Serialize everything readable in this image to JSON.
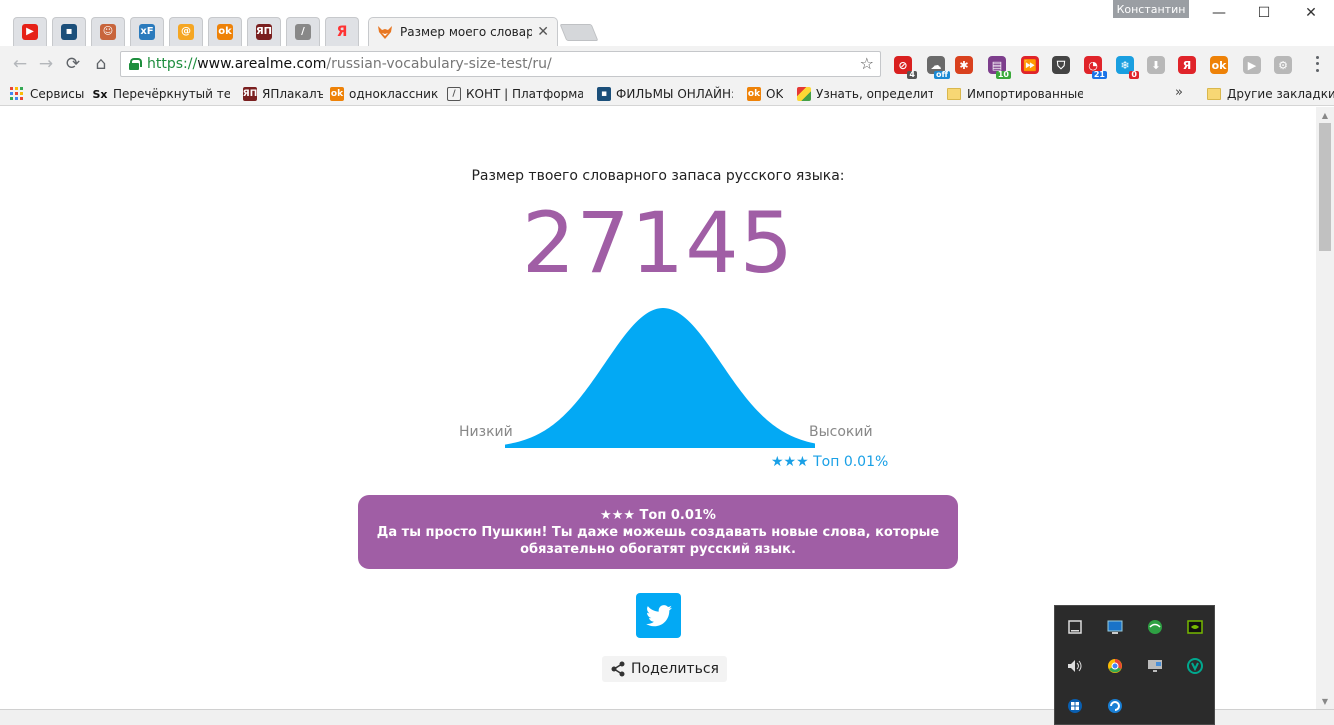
{
  "window": {
    "user_name": "Константин",
    "minimize": "—",
    "maximize": "☐",
    "close": "✕"
  },
  "tabs": {
    "pinned": [
      {
        "icon": "youtube-icon",
        "glyph": "▶",
        "color": "#e62117"
      },
      {
        "icon": "tv-icon",
        "glyph": "▪",
        "color": "#1b4f7a"
      },
      {
        "icon": "mask-icon",
        "glyph": "☺",
        "color": "#c8653c"
      },
      {
        "icon": "xf-icon",
        "glyph": "xF",
        "color": "#2b7bbd"
      },
      {
        "icon": "mail-at-icon",
        "glyph": "@",
        "color": "#f5a623"
      },
      {
        "icon": "odnoklassniki-icon",
        "glyph": "ok",
        "color": "#ee8208"
      },
      {
        "icon": "yaplakal-icon",
        "glyph": "ЯП",
        "color": "#7a1f1f"
      },
      {
        "icon": "kont-icon",
        "glyph": "/",
        "color": "#555555"
      },
      {
        "icon": "yandex-icon",
        "glyph": "Я",
        "color": "#ff3333"
      }
    ],
    "active_title": "Размер моего словарного запаса",
    "active_close": "✕"
  },
  "toolbar": {
    "back": "←",
    "forward": "→",
    "reload": "⟳",
    "home": "⌂",
    "url_scheme": "https://",
    "url_host": "www.arealme.com",
    "url_path": "/russian-vocabulary-size-test/ru/",
    "bookmark_star": "☆",
    "extensions": [
      {
        "icon": "adblock-icon",
        "glyph": "⊘",
        "color": "#d9201f",
        "badge": "4",
        "badge_color": "#555555"
      },
      {
        "icon": "cloud-off-icon",
        "glyph": "☁",
        "color": "#6a6a6a",
        "badge": "off",
        "badge_color": "#1a8ad4"
      },
      {
        "icon": "gear-red-icon",
        "glyph": "✱",
        "color": "#d9411e",
        "badge": "",
        "badge_color": ""
      },
      {
        "icon": "wallet-icon",
        "glyph": "▤",
        "color": "#7d3e8c",
        "badge": "10",
        "badge_color": "#3aa93a"
      },
      {
        "icon": "forward-red-icon",
        "glyph": "⏩",
        "color": "#e0242a",
        "badge": "",
        "badge_color": ""
      },
      {
        "icon": "shield-icon",
        "glyph": "⛉",
        "color": "#444444",
        "badge": "",
        "badge_color": ""
      },
      {
        "icon": "chrome-notify-icon",
        "glyph": "◔",
        "color": "#e0242a",
        "badge": "21",
        "badge_color": "#1a73e8"
      },
      {
        "icon": "snowflake-icon",
        "glyph": "❄",
        "color": "#1a9fe0",
        "badge": "0",
        "badge_color": "#e0242a"
      },
      {
        "icon": "download-icon",
        "glyph": "⬇",
        "color": "#b8b8b8",
        "badge": "",
        "badge_color": ""
      },
      {
        "icon": "yandex-ext-icon",
        "glyph": "Я",
        "color": "#e0242a",
        "badge": "",
        "badge_color": ""
      },
      {
        "icon": "ok-ext-icon",
        "glyph": "ok",
        "color": "#ee8208",
        "badge": "",
        "badge_color": ""
      },
      {
        "icon": "play-ext-icon",
        "glyph": "▶",
        "color": "#b8b8b8",
        "badge": "",
        "badge_color": ""
      },
      {
        "icon": "settings-ext-icon",
        "glyph": "⚙",
        "color": "#b8b8b8",
        "badge": "",
        "badge_color": ""
      }
    ]
  },
  "bookmarks": {
    "items": [
      {
        "label": "Сервисы",
        "icon": "apps-grid-icon"
      },
      {
        "label": "Перечёркнутый текст",
        "icon": "sx-icon"
      },
      {
        "label": "ЯПлакалъ",
        "icon": "yaplakal-icon"
      },
      {
        "label": "одноклассники",
        "icon": "odnoklassniki-icon"
      },
      {
        "label": "КОНТ | Платформа для",
        "icon": "kont-icon"
      },
      {
        "label": "ФИЛЬМЫ ОНЛАЙН: с",
        "icon": "tv-icon"
      },
      {
        "label": "OK",
        "icon": "odnoklassniki-icon"
      },
      {
        "label": "Узнать, определить, и",
        "icon": "cube-icon"
      },
      {
        "label": "Импортированные и",
        "icon": "folder-icon"
      }
    ],
    "more": "»",
    "other_label": "Другие закладки"
  },
  "content": {
    "heading": "Размер твоего словарного запаса русского языка:",
    "score": "27145",
    "low_label": "Низкий",
    "high_label": "Высокий",
    "rank_small": "★★★ Топ 0.01%",
    "result_title": "★★★ Топ 0.01%",
    "result_line1": "Да ты просто Пушкин! Ты даже можешь создавать новые слова, которые",
    "result_line2": "обязательно обогатят русский язык.",
    "share_label": "Поделиться",
    "colors": {
      "accent_purple": "#a05ea5",
      "curve_blue": "#03a9f4",
      "rank_blue": "#1aa0e6"
    },
    "curve_percentile": 0.9999
  },
  "tray": {
    "icons": [
      "tablet-icon",
      "network-monitor-icon",
      "browser-globe-icon",
      "nvidia-icon",
      "volume-icon",
      "chrome-tray-icon",
      "display-icon",
      "kaspersky-icon",
      "windows-app-icon",
      "refresh-tray-icon"
    ]
  }
}
